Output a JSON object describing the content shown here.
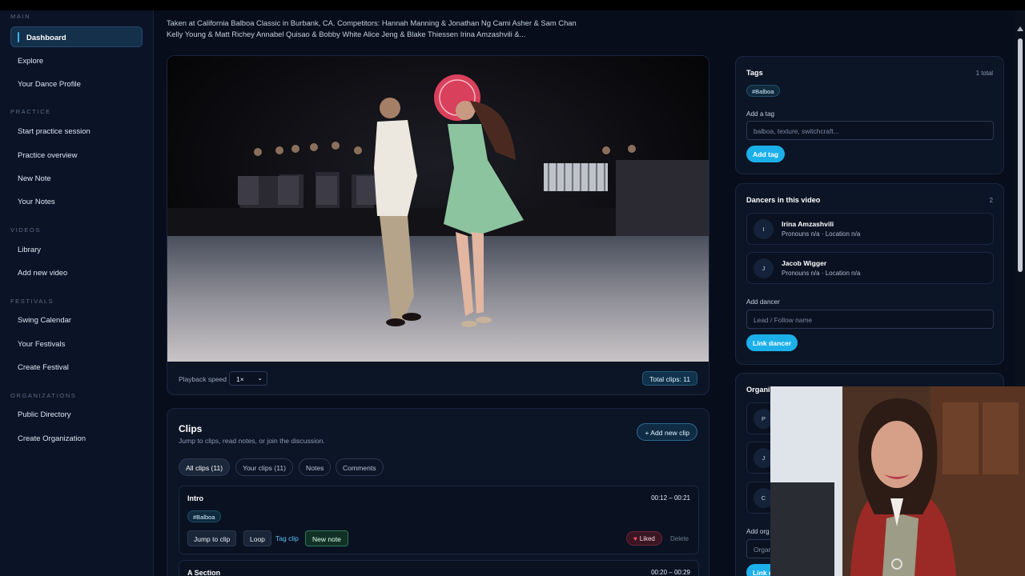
{
  "sidebar": {
    "sections": {
      "main": "MAIN",
      "practice": "PRACTICE",
      "videos": "VIDEOS",
      "festivals": "FESTIVALS",
      "organizations": "ORGANIZATIONS"
    },
    "items": {
      "dashboard": "Dashboard",
      "explore": "Explore",
      "profile": "Your Dance Profile",
      "start_practice": "Start practice session",
      "practice_overview": "Practice overview",
      "new_note": "New Note",
      "your_notes": "Your Notes",
      "library": "Library",
      "add_video": "Add new video",
      "swing_calendar": "Swing Calendar",
      "your_festivals": "Your Festivals",
      "create_festival": "Create Festival",
      "public_directory": "Public Directory",
      "create_org": "Create Organization"
    }
  },
  "video": {
    "description_line1": "Taken at California Balboa Classic in Burbank, CA. Competitors: Hannah Manning & Jonathan Ng Cami Asher & Sam Chan",
    "description_line2": "Kelly Young & Matt Richey Annabel Quisao & Bobby White Alice Jeng & Blake Thiessen Irina Amzashvili &...",
    "playback_label": "Playback speed",
    "playback_value": "1×",
    "total_clips": "Total clips: 11"
  },
  "clips": {
    "title": "Clips",
    "subtitle": "Jump to clips, read notes, or join the discussion.",
    "add_button": "+ Add new clip",
    "tabs": [
      "All clips (11)",
      "Your clips (11)",
      "Notes",
      "Comments"
    ],
    "items": [
      {
        "name": "Intro",
        "time": "00:12 – 00:21",
        "tag": "#Balboa",
        "jump": "Jump to clip",
        "loop": "Loop",
        "tag_clip": "Tag clip",
        "new_note": "New note",
        "liked": "Liked",
        "delete": "Delete"
      },
      {
        "name": "A Section",
        "time": "00:20 – 00:29"
      }
    ]
  },
  "tags_panel": {
    "title": "Tags",
    "count": "1 total",
    "tag": "#Balboa",
    "add_label": "Add a tag",
    "placeholder": "balboa, texture, switchcraft...",
    "button": "Add tag"
  },
  "dancers_panel": {
    "title": "Dancers in this video",
    "count": "2",
    "dancers": [
      {
        "initial": "I",
        "name": "Irina Amzashvili",
        "meta": "Pronouns n/a · Location n/a"
      },
      {
        "initial": "J",
        "name": "Jacob Wigger",
        "meta": "Pronouns n/a · Location n/a"
      }
    ],
    "add_label": "Add dancer",
    "placeholder": "Lead / Follow name",
    "button": "Link dancer"
  },
  "org_panel": {
    "title_partial": "Organi",
    "initials": [
      "P",
      "J",
      "C"
    ],
    "add_label_partial": "Add org",
    "input_partial": "Organ",
    "button_partial": "Link o"
  },
  "colors": {
    "accent": "#1cb0ea",
    "background": "#070d1a",
    "panel": "#0c1526",
    "liked": "#ff4d6a"
  }
}
